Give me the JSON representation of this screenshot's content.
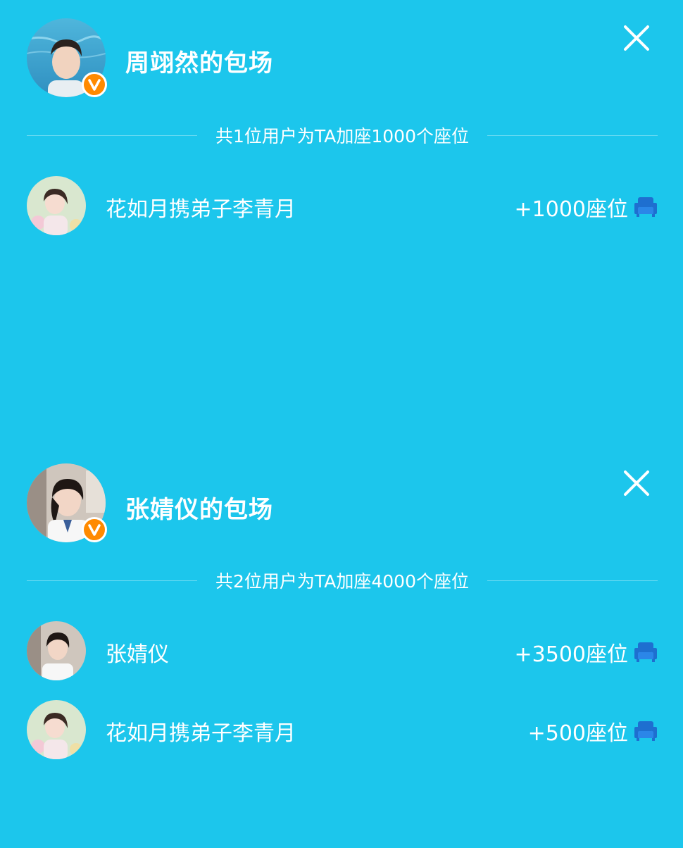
{
  "panels": [
    {
      "title": "周翊然的包场",
      "summary": "共1位用户为TA加座1000个座位",
      "contributors": [
        {
          "name": "花如月携弟子李青月",
          "seats": "+1000座位"
        }
      ]
    },
    {
      "title": "张婧仪的包场",
      "summary": "共2位用户为TA加座4000个座位",
      "contributors": [
        {
          "name": "张婧仪",
          "seats": "+3500座位"
        },
        {
          "name": "花如月携弟子李青月",
          "seats": "+500座位"
        }
      ]
    }
  ],
  "colors": {
    "background": "#1cc6ec",
    "badge": "#ff8a00",
    "seat_icon": "#1e6fd0"
  },
  "icons": {
    "close": "close-icon",
    "verified": "verified-v-badge-icon",
    "seat": "armchair-seat-icon"
  }
}
